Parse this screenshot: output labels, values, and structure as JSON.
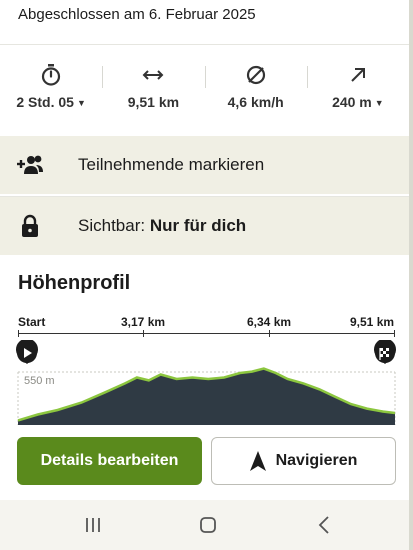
{
  "header": {
    "completed_text": "Abgeschlossen am 6. Februar 2025"
  },
  "stats": [
    {
      "icon": "stopwatch-icon",
      "value": "2 Std. 05",
      "dropdown": true
    },
    {
      "icon": "distance-arrows-icon",
      "value": "9,51 km",
      "dropdown": false
    },
    {
      "icon": "average-speed-icon",
      "value": "4,6 km/h",
      "dropdown": false
    },
    {
      "icon": "elevation-up-icon",
      "value": "240 m",
      "dropdown": true
    }
  ],
  "participants": {
    "icon": "add-people-icon",
    "label": "Teilnehmende markieren"
  },
  "visibility": {
    "icon": "lock-icon",
    "prefix": "Sichtbar:",
    "value": "Nur für dich"
  },
  "elevation_profile": {
    "title": "Höhenprofil",
    "axis_labels": [
      "Start",
      "3,17 km",
      "6,34 km",
      "9,51 km"
    ],
    "y_label": "550 m",
    "start_icon": "start-flag-icon",
    "finish_icon": "finish-flag-icon",
    "colors": {
      "fill": "#2f3a44",
      "line": "#8cc63f"
    }
  },
  "chart_data": {
    "type": "area",
    "title": "Höhenprofil",
    "xlabel": "",
    "ylabel": "",
    "x_tick_labels": [
      "Start",
      "3,17 km",
      "6,34 km",
      "9,51 km"
    ],
    "y_tick_labels": [
      "550 m"
    ],
    "xlim": [
      0,
      9.51
    ],
    "series": [
      {
        "x": [
          0,
          0.5,
          1.0,
          1.6,
          2.2,
          2.7,
          3.0,
          3.3,
          3.6,
          4.0,
          4.4,
          4.8,
          5.2,
          5.6,
          5.9,
          6.2,
          6.5,
          6.8,
          7.2,
          7.6,
          8.0,
          8.4,
          8.8,
          9.2,
          9.51
        ],
        "y": [
          520,
          524,
          527,
          532,
          539,
          545,
          549,
          547,
          551,
          548,
          549,
          548,
          549,
          552,
          553,
          555,
          552,
          548,
          545,
          541,
          536,
          531,
          528,
          526,
          525
        ]
      }
    ]
  },
  "actions": {
    "primary": "Details bearbeiten",
    "secondary": "Navigieren",
    "secondary_icon": "navigation-arrow-icon"
  },
  "system_nav": {
    "recents_icon": "recents-icon",
    "home_icon": "home-icon",
    "back_icon": "back-icon"
  }
}
